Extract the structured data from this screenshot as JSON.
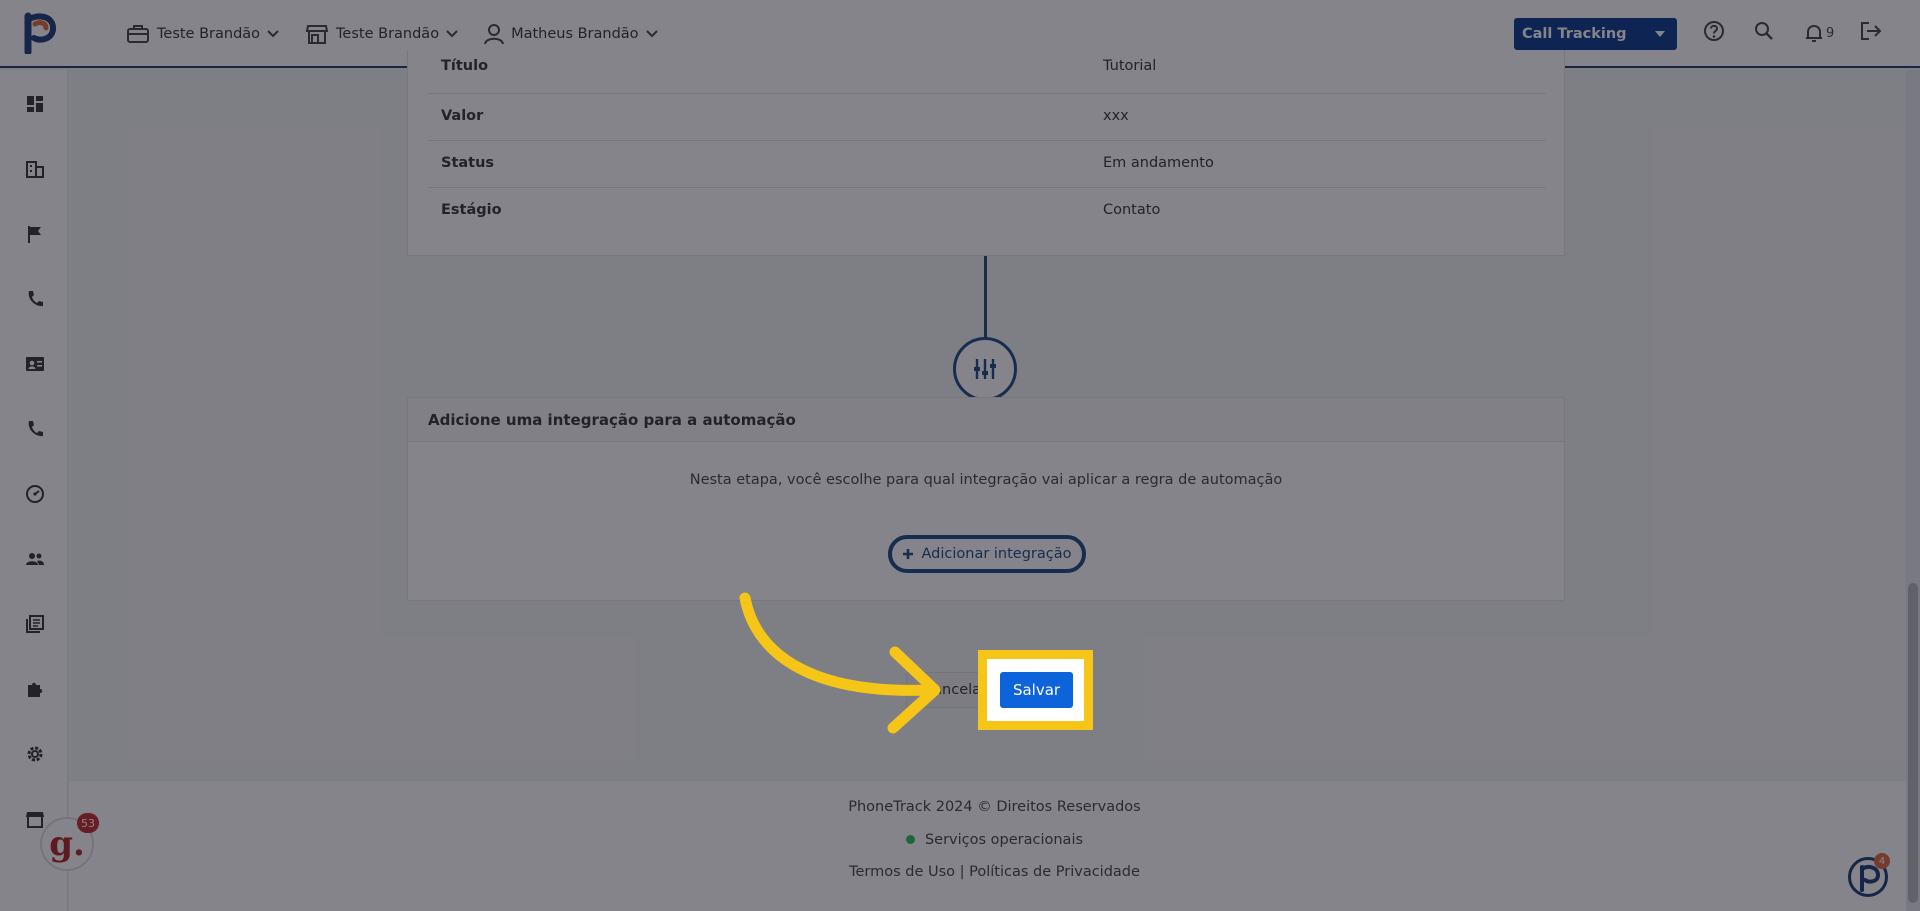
{
  "header": {
    "nav": [
      {
        "label": "Teste Brandão",
        "icon": "briefcase-icon"
      },
      {
        "label": "Teste Brandão",
        "icon": "store-icon"
      },
      {
        "label": "Matheus Brandão",
        "icon": "user-icon"
      }
    ],
    "product_select": "Call Tracking",
    "notification_count": "9"
  },
  "sidebar": {
    "items": [
      "dashboard-icon",
      "building-icon",
      "flag-icon",
      "phone-icon",
      "contact-card-icon",
      "phone-icon",
      "speedometer-icon",
      "users-icon",
      "library-icon",
      "puzzle-icon",
      "gear-icon",
      "store-icon"
    ]
  },
  "details": {
    "rows": [
      {
        "label": "Título",
        "value": "Tutorial"
      },
      {
        "label": "Valor",
        "value": "xxx"
      },
      {
        "label": "Status",
        "value": "Em andamento"
      },
      {
        "label": "Estágio",
        "value": "Contato"
      }
    ]
  },
  "integration": {
    "title": "Adicione uma integração para a automação",
    "description": "Nesta etapa, você escolhe para qual integração vai aplicar a regra de automação",
    "add_button": "Adicionar integração"
  },
  "actions": {
    "cancel": "Cancelar",
    "save": "Salvar"
  },
  "footer": {
    "copyright": "PhoneTrack 2024 © Direitos Reservados",
    "status": "Serviços operacionais",
    "terms": "Termos de Uso",
    "separator": "|",
    "privacy": "Políticas de Privacidade"
  },
  "widgets": {
    "g_letter": "g.",
    "g_badge": "53",
    "p_badge": "4"
  },
  "colors": {
    "brand_navy": "#1c3a78",
    "primary_blue": "#0d63d9",
    "highlight_yellow": "#f5c518",
    "status_green": "#2bbf5b"
  }
}
